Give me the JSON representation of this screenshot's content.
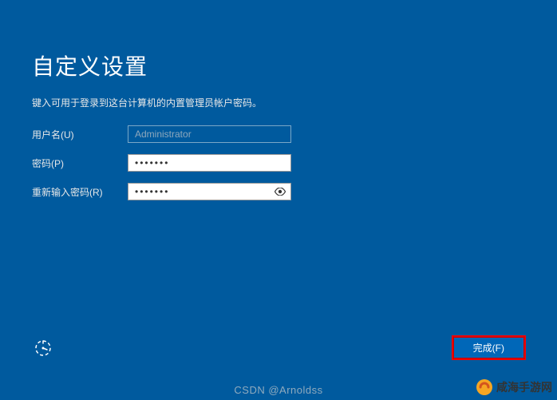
{
  "header": {
    "title": "自定义设置",
    "instruction": "键入可用于登录到这台计算机的内置管理员帐户密码。"
  },
  "form": {
    "username": {
      "label": "用户名(U)",
      "value": "Administrator"
    },
    "password": {
      "label": "密码(P)",
      "value": "•••••••"
    },
    "confirm_password": {
      "label": "重新输入密码(R)",
      "value": "•••••••"
    }
  },
  "actions": {
    "finish_label": "完成(F)"
  },
  "watermarks": {
    "csdn": "CSDN @Arnoldss",
    "site": "咸海手游网"
  }
}
